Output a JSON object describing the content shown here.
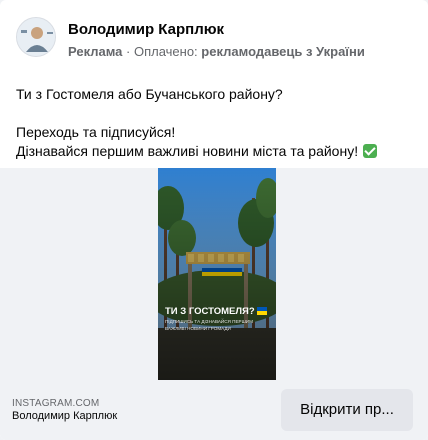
{
  "post": {
    "author": "Володимир Карплюк",
    "ad_label": "Реклама",
    "separator": " · ",
    "paid_prefix": "Оплачено: ",
    "paid_by": "рекламодавець з України",
    "text": {
      "line1": "Ти з Гостомеля або Бучанського району?",
      "line2": "Переходь та підписуйся!",
      "line3": "Дізнавайся першим важливі новини міста та району!"
    }
  },
  "media": {
    "headline": "ТИ З ГОСТОМЕЛЯ?",
    "subline1": "ПІДПИШИСЬ ТА ДІЗНАВАЙСЯ ПЕРШИМ",
    "subline2": "ВАЖЛИВІ НОВИНИ ГРОМАДИ"
  },
  "footer": {
    "source_domain": "INSTAGRAM.COM",
    "source_name": "Володимир Карплюк",
    "cta_label": "Відкрити пр..."
  },
  "colors": {
    "flag_blue": "#0057b7",
    "flag_yellow": "#ffd700",
    "cta_bg": "#e4e6eb",
    "meta_text": "#65676b"
  },
  "icons": {
    "check": "check-mark-icon"
  }
}
